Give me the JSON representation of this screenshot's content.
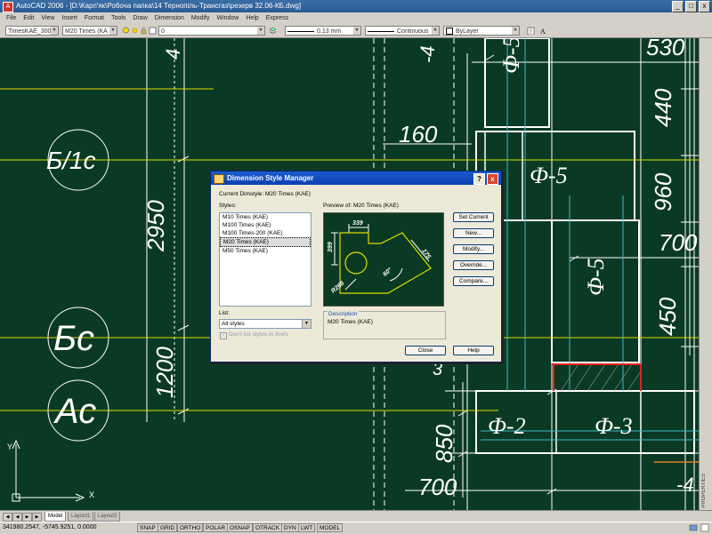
{
  "window": {
    "title": "AutoCAD 2006 - [D:\\Карп'як\\Робоча папка\\14 Тернопіль-Трансгаз\\резерв 32.06-КБ.dwg]",
    "app_icon": "A",
    "controls": [
      "_",
      "□",
      "x"
    ]
  },
  "menu": [
    "File",
    "Edit",
    "View",
    "Insert",
    "Format",
    "Tools",
    "Draw",
    "Dimension",
    "Modify",
    "Window",
    "Help",
    "Express"
  ],
  "toolbar": {
    "text_style": "TimesKAE_300",
    "dim_style": "M20 Times (KA",
    "layer": "0",
    "lineweight": "0.13 mm",
    "linetype": "Continuous",
    "color": "ByLayer"
  },
  "drawing": {
    "labels": [
      "Б/1с",
      "Бс",
      "Ас",
      "2950",
      "1200",
      "160",
      "Ф-5",
      "Ф-5",
      "Ф-5",
      "Ф-2",
      "Ф-3",
      "530",
      "440",
      "960",
      "700",
      "450",
      "850",
      "700",
      "3",
      "-4",
      "4",
      "-4"
    ],
    "ucs": {
      "x": "X",
      "y": "Y"
    }
  },
  "dialog": {
    "title": "Dimension Style Manager",
    "help_btn": "?",
    "close_btn": "x",
    "current_dimstyle": "Current Dimstyle: M20 Times (KAE)",
    "styles_label": "Styles:",
    "styles": [
      "M10 Times (KAE)",
      "M100 Times (KAE)",
      "M100 Times-200 (KAE)",
      "M20 Times (KAE)",
      "M50 Times (KAE)"
    ],
    "selected_index": 3,
    "preview_label": "Preview of: M20 Times (KAE)",
    "preview_dims": [
      "339",
      "399",
      "175",
      "R268",
      "60°"
    ],
    "list_label": "List:",
    "list_value": "All styles",
    "dont_list_xrefs": "Don't list styles in Xrefs",
    "description_label": "Description",
    "description_text": "M20 Times (KAE)",
    "buttons": {
      "set_current": "Set Current",
      "new": "New...",
      "modify": "Modify...",
      "override": "Override...",
      "compare": "Compare...",
      "close": "Close",
      "help": "Help"
    }
  },
  "tabs": [
    "Model",
    "Layout1",
    "Layout2"
  ],
  "active_tab": "Model",
  "status": {
    "coords": "341980.2547, -5745.9251, 0.0000",
    "toggles": [
      "SNAP",
      "GRID",
      "ORTHO",
      "POLAR",
      "OSNAP",
      "OTRACK",
      "DYN",
      "LWT",
      "MODEL"
    ]
  },
  "side_palette": "PROPERTIES",
  "colors": {
    "background": "#0b3a24",
    "title_blue": "#2a5a94",
    "dialog_face": "#ece9d8",
    "accent_red": "#e0201f",
    "cyan_line": "#3fb8c6"
  }
}
